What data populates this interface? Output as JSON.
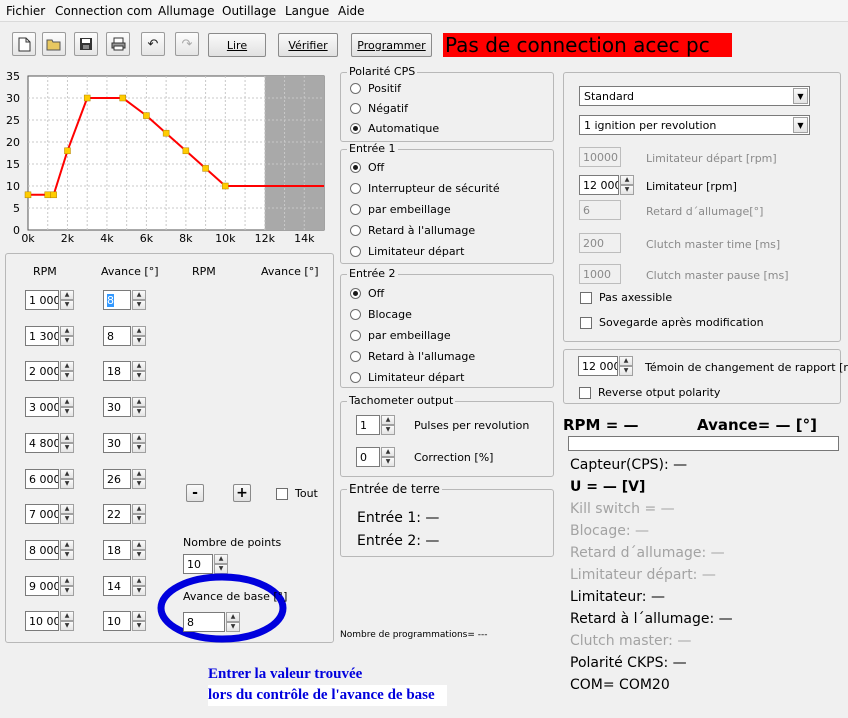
{
  "menu": [
    "Fichier",
    "Connection com",
    "Allumage",
    "Outillage",
    "Langue",
    "Aide"
  ],
  "toolbar": {
    "icons": [
      "new-file-icon",
      "open-folder-icon",
      "save-disk-icon",
      "print-icon",
      "undo-icon",
      "redo-icon"
    ],
    "read_label": "Lire",
    "verify_label": "Vérifier",
    "program_label": "Programmer",
    "status": "Pas de connection acec pc",
    "status_color": "#ff0000"
  },
  "chart_data": {
    "type": "line",
    "x": [
      0,
      1000,
      1300,
      2000,
      3000,
      4800,
      6000,
      7000,
      8000,
      9000,
      10000,
      15000
    ],
    "y": [
      8,
      8,
      8,
      18,
      30,
      30,
      26,
      22,
      18,
      14,
      10,
      10
    ],
    "markers": [
      0,
      1000,
      1300,
      2000,
      3000,
      4800,
      6000,
      7000,
      8000,
      9000,
      10000
    ],
    "xticks": [
      "0k",
      "2k",
      "4k",
      "6k",
      "8k",
      "10k",
      "12k",
      "14k"
    ],
    "yticks": [
      "0",
      "5",
      "10",
      "15",
      "20",
      "25",
      "30",
      "35"
    ],
    "xlim": [
      0,
      15000
    ],
    "ylim": [
      0,
      35
    ],
    "shaded_from": 12000,
    "grid": true,
    "line_color": "#ff0000",
    "marker_color": "#ffcc00"
  },
  "table": {
    "headers": [
      "RPM",
      "Avance [°]",
      "RPM",
      "Avance [°]"
    ],
    "rows": [
      {
        "rpm": "1 000",
        "adv": "8"
      },
      {
        "rpm": "1 300",
        "adv": "8"
      },
      {
        "rpm": "2 000",
        "adv": "18"
      },
      {
        "rpm": "3 000",
        "adv": "30"
      },
      {
        "rpm": "4 800",
        "adv": "30"
      },
      {
        "rpm": "6 000",
        "adv": "26"
      },
      {
        "rpm": "7 000",
        "adv": "22"
      },
      {
        "rpm": "8 000",
        "adv": "18"
      },
      {
        "rpm": "9 000",
        "adv": "14"
      },
      {
        "rpm": "10 000",
        "adv": "10"
      }
    ],
    "minus_label": "-",
    "plus_label": "+",
    "tout_label": "Tout",
    "nb_points_label": "Nombre de points",
    "nb_points_value": "10",
    "base_adv_label": "Avance de base [°]",
    "base_adv_value": "8",
    "highlight_color": "#0000dd"
  },
  "polarite": {
    "title": "Polarité CPS",
    "options": [
      "Positif",
      "Négatif",
      "Automatique"
    ],
    "selected": 2
  },
  "entree1": {
    "title": "Entrée 1",
    "options": [
      "Off",
      "Interrupteur de sécurité",
      "par embeillage",
      "Retard à l'allumage",
      "Limitateur départ"
    ],
    "selected": 0
  },
  "entree2": {
    "title": "Entrée 2",
    "options": [
      "Off",
      "Blocage",
      "par embeillage",
      "Retard à l'allumage",
      "Limitateur départ"
    ],
    "selected": 0
  },
  "tacho": {
    "title": "Tachometer output",
    "pulses_value": "1",
    "pulses_label": "Pulses per revolution",
    "correction_value": "0",
    "correction_label": "Correction [%]"
  },
  "terre": {
    "title": "Entrée de terre",
    "e1": "Entrée 1: —",
    "e2": "Entrée 2: —"
  },
  "nb_prog": "Nombre de programmations= ---",
  "settings": {
    "mode": "Standard",
    "ignition": "1 ignition per revolution",
    "lim_depart_value": "10000",
    "lim_depart_label": "Limitateur départ [rpm]",
    "lim_value": "12 000",
    "lim_label": "Limitateur [rpm]",
    "retard_value": "6",
    "retard_label": "Retard d´allumage[°]",
    "clutch_time_value": "200",
    "clutch_time_label": "Clutch master time [ms]",
    "clutch_pause_value": "1000",
    "clutch_pause_label": "Clutch master pause [ms]",
    "pas_axessible": "Pas axessible",
    "sovegarde": "Sovegarde après modification"
  },
  "shift": {
    "value": "12 000",
    "label": "Témoin de changement de rapport [rpm]",
    "reverse": "Reverse otput polarity"
  },
  "status": {
    "rpm": "RPM = —",
    "avance": "Avance= — [°]",
    "capteur": "Capteur(CPS): —",
    "voltage": "U = — [V]",
    "kill": "Kill switch = —",
    "blocage": "Blocage: —",
    "retard": "Retard d´allumage: —",
    "lim_depart": "Limitateur départ: —",
    "limitateur": "Limitateur: —",
    "retard2": "Retard à l´allumage: —",
    "clutch": "Clutch master: —",
    "polarite": "Polarité CKPS: —",
    "com": "COM= COM20"
  },
  "annotation": {
    "line1": "Entrer la valeur trouvée",
    "line2": "lors du contrôle de l'avance de base",
    "color": "#0000dd"
  }
}
